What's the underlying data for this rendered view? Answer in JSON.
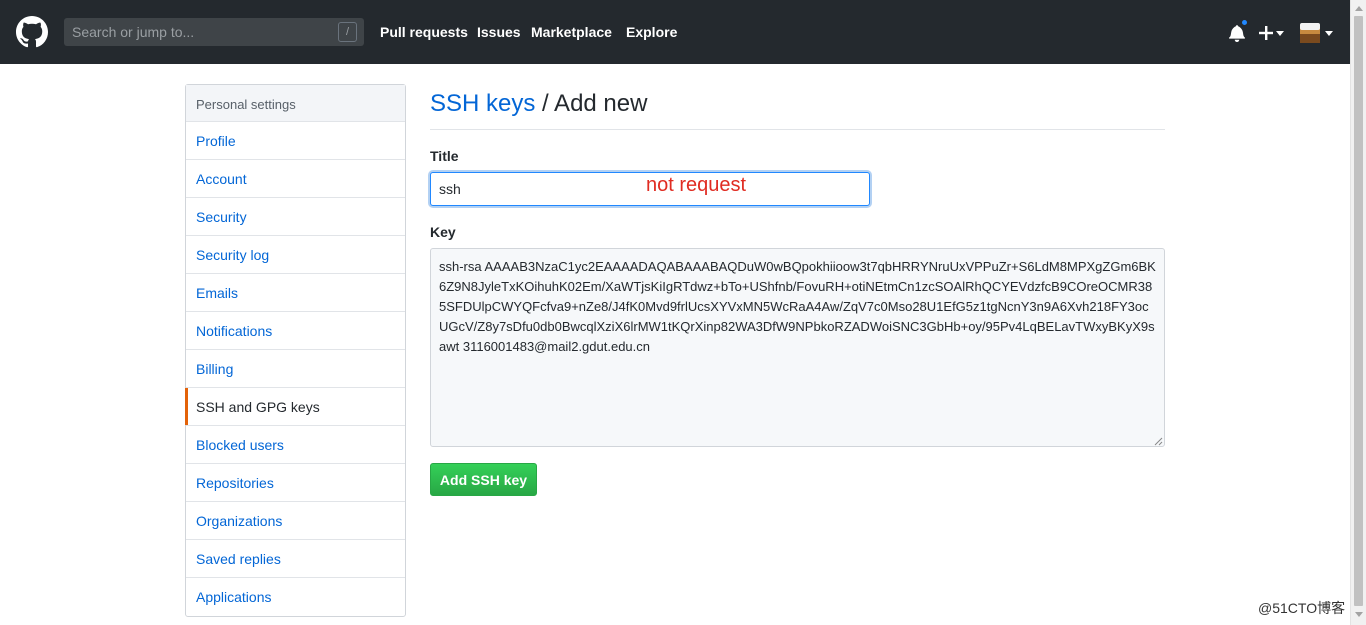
{
  "header": {
    "search_placeholder": "Search or jump to...",
    "search_shortcut": "/",
    "nav": [
      "Pull requests",
      "Issues",
      "Marketplace",
      "Explore"
    ]
  },
  "sidebar": {
    "heading": "Personal settings",
    "items": [
      {
        "label": "Profile"
      },
      {
        "label": "Account"
      },
      {
        "label": "Security"
      },
      {
        "label": "Security log"
      },
      {
        "label": "Emails"
      },
      {
        "label": "Notifications"
      },
      {
        "label": "Billing"
      },
      {
        "label": "SSH and GPG keys",
        "selected": true
      },
      {
        "label": "Blocked users"
      },
      {
        "label": "Repositories"
      },
      {
        "label": "Organizations"
      },
      {
        "label": "Saved replies"
      },
      {
        "label": "Applications"
      }
    ]
  },
  "main": {
    "breadcrumb_link": "SSH keys",
    "breadcrumb_rest": " / Add new",
    "title_label": "Title",
    "title_value": "ssh",
    "annotation": "not request",
    "key_label": "Key",
    "key_value": "ssh-rsa AAAAB3NzaC1yc2EAAAADAQABAAABAQDuW0wBQpokhiioow3t7qbHRRYNruUxVPPuZr+S6LdM8MPXgZGm6BK6Z9N8JyleTxKOihuhK02Em/XaWTjsKiIgRTdwz+bTo+UShfnb/FovuRH+otiNEtmCn1zcSOAlRhQCYEVdzfcB9COreOCMR385SFDUlpCWYQFcfva9+nZe8/J4fK0Mvd9frlUcsXYVxMN5WcRaA4Aw/ZqV7c0Mso28U1EfG5z1tgNcnY3n9A6Xvh218FY3ocUGcV/Z8y7sDfu0db0BwcqlXziX6lrMW1tKQrXinp82WA3DfW9NPbkoRZADWoiSNC3GbHb+oy/95Pv4LqBELavTWxyBKyX9sawt 3116001483@mail2.gdut.edu.cn",
    "add_button": "Add SSH key"
  },
  "watermark": "@51CTO博客",
  "colors": {
    "header_bg": "#24292e",
    "link": "#0366d6",
    "selected_marker": "#e36209",
    "button_green": "#28a745",
    "annotation_red": "#e02c22",
    "notification_dot": "#2188ff"
  },
  "icons": [
    "github-logo-icon",
    "bell-icon",
    "plus-icon",
    "caret-down-icon",
    "avatar"
  ]
}
